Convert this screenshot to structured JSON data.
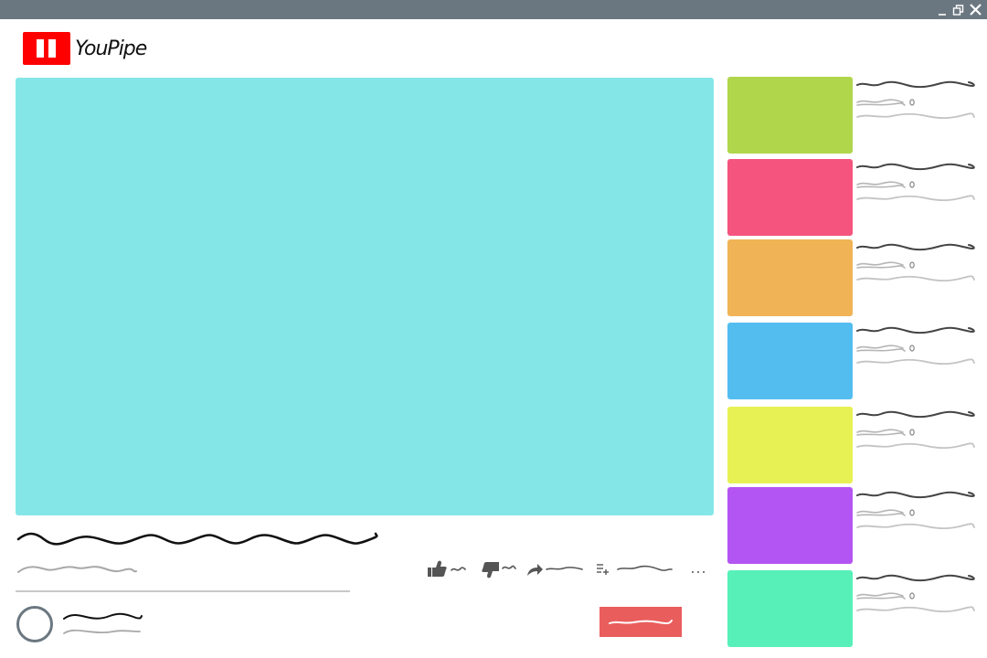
{
  "window": {
    "controls": [
      {
        "icon": "minimize-icon"
      },
      {
        "icon": "restore-icon"
      },
      {
        "icon": "close-icon"
      }
    ]
  },
  "header": {
    "logo_icon": "pause-icon",
    "logo_text": "YouPipe",
    "brand_color": "#ff0000"
  },
  "player": {
    "color": "#85e6e8"
  },
  "video": {
    "actions": [
      {
        "icon": "thumbs-up-icon"
      },
      {
        "icon": "thumbs-down-icon"
      },
      {
        "icon": "share-icon"
      },
      {
        "icon": "add-to-playlist-icon"
      },
      {
        "icon": "more-icon"
      }
    ]
  },
  "channel": {
    "subscribe_color": "#ea5d5d"
  },
  "sidebar": {
    "items": [
      {
        "thumb_color": "#b0d64c"
      },
      {
        "thumb_color": "#f4547e"
      },
      {
        "thumb_color": "#f0b356"
      },
      {
        "thumb_color": "#53bdf0"
      },
      {
        "thumb_color": "#e7f153"
      },
      {
        "thumb_color": "#b355f2"
      },
      {
        "thumb_color": "#56f0b8"
      }
    ]
  }
}
